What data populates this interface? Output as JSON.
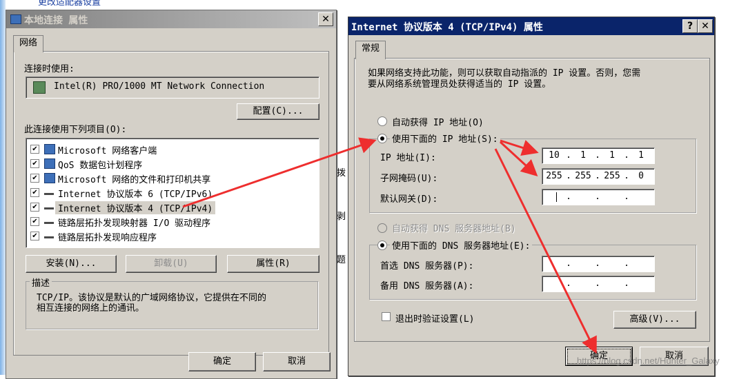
{
  "background": {
    "top_text": "更改适配器设置",
    "fragments": [
      "拨",
      "剥",
      "题"
    ]
  },
  "left_dialog": {
    "title": "本地连接 属性",
    "close_glyph": "✕",
    "tab": "网络",
    "connect_using_label": "连接时使用:",
    "adapter_name": "Intel(R) PRO/1000 MT Network Connection",
    "configure_button": "配置(C)...",
    "items_label": "此连接使用下列项目(O):",
    "items": [
      {
        "label": "Microsoft 网络客户端",
        "checked": true,
        "icon": "network-client-icon"
      },
      {
        "label": "QoS 数据包计划程序",
        "checked": true,
        "icon": "qos-icon"
      },
      {
        "label": "Microsoft 网络的文件和打印机共享",
        "checked": true,
        "icon": "file-share-icon"
      },
      {
        "label": "Internet 协议版本 6 (TCP/IPv6)",
        "checked": true,
        "icon": "protocol-icon"
      },
      {
        "label": "Internet 协议版本 4 (TCP/IPv4)",
        "checked": true,
        "icon": "protocol-icon",
        "selected": true
      },
      {
        "label": "链路层拓扑发现映射器 I/O 驱动程序",
        "checked": true,
        "icon": "protocol-icon"
      },
      {
        "label": "链路层拓扑发现响应程序",
        "checked": true,
        "icon": "protocol-icon"
      }
    ],
    "install_button": "安装(N)...",
    "uninstall_button": "卸载(U)",
    "properties_button": "属性(R)",
    "description_label": "描述",
    "description_text_line1": "TCP/IP。该协议是默认的广域网络协议，它提供在不同的",
    "description_text_line2": "相互连接的网络上的通讯。",
    "ok_button": "确定",
    "cancel_button": "取消"
  },
  "right_dialog": {
    "title": "Internet 协议版本 4 (TCP/IPv4) 属性",
    "help_glyph": "?",
    "close_glyph": "✕",
    "title_bg": "#0a246a",
    "tab": "常规",
    "intro_line1": "如果网络支持此功能，则可以获取自动指派的 IP 设置。否则，您需",
    "intro_line2": "要从网络系统管理员处获得适当的 IP 设置。",
    "auto_ip_label": "自动获得 IP 地址(O)",
    "manual_ip_label": "使用下面的 IP 地址(S):",
    "ip_label": "IP 地址(I):",
    "ip_value": [
      "10",
      "1",
      "1",
      "1"
    ],
    "subnet_label": "子网掩码(U):",
    "subnet_value": [
      "255",
      "255",
      "255",
      "0"
    ],
    "gateway_label": "默认网关(D):",
    "gateway_value": [
      "",
      "",
      "",
      ""
    ],
    "auto_dns_label": "自动获得 DNS 服务器地址(B)",
    "manual_dns_label": "使用下面的 DNS 服务器地址(E):",
    "preferred_dns_label": "首选 DNS 服务器(P):",
    "alternate_dns_label": "备用 DNS 服务器(A):",
    "validate_label": "退出时验证设置(L)",
    "advanced_button": "高级(V)...",
    "ok_button": "确定",
    "cancel_button": "取消"
  },
  "watermark": "https://blog.csdn.net/Hunter_Galaxy",
  "annotation_color": "#ee2e2e"
}
